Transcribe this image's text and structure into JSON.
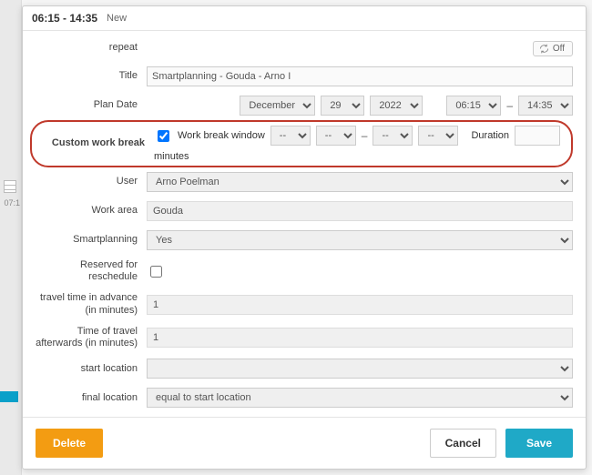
{
  "bg": {
    "slot_time": "07:1"
  },
  "header": {
    "time_range": "06:15 - 14:35",
    "status": "New"
  },
  "repeat": {
    "label": "repeat",
    "toggle": "Off"
  },
  "title": {
    "label": "Title",
    "value": "Smartplanning - Gouda - Arno I"
  },
  "plan_date": {
    "label": "Plan Date",
    "month": "December",
    "day": "29",
    "year": "2022",
    "start": "06:15",
    "end": "14:35"
  },
  "custom_break": {
    "label": "Custom work break",
    "checked": true,
    "window_label": "Work break window",
    "h1": "--",
    "m1": "--",
    "h2": "--",
    "m2": "--",
    "duration_label": "Duration",
    "duration_value": "",
    "duration_unit": "minutes"
  },
  "user": {
    "label": "User",
    "value": "Arno Poelman"
  },
  "work_area": {
    "label": "Work area",
    "value": "Gouda"
  },
  "smartplanning": {
    "label": "Smartplanning",
    "value": "Yes"
  },
  "reserved": {
    "label": "Reserved for reschedule",
    "checked": false
  },
  "travel_before": {
    "label": "travel time in advance (in minutes)",
    "value": "1"
  },
  "travel_after": {
    "label": "Time of travel afterwards (in minutes)",
    "value": "1"
  },
  "start_location": {
    "label": "start location",
    "value": ""
  },
  "final_location": {
    "label": "final location",
    "value": "equal to start location"
  },
  "buttons": {
    "delete": "Delete",
    "cancel": "Cancel",
    "save": "Save"
  }
}
